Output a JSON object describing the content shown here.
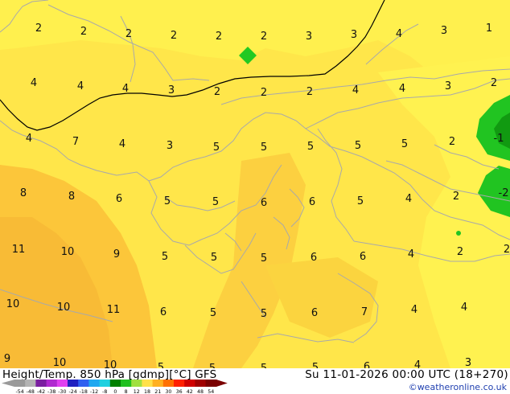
{
  "footer": {
    "title": "Height/Temp. 850 hPa [gdmp][°C] GFS",
    "datetime": "Su 11-01-2026 00:00 UTC (18+270)",
    "credit": "©weatheronline.co.uk"
  },
  "legend": {
    "ticks": [
      "-54",
      "-48",
      "-42",
      "-38",
      "-30",
      "-24",
      "-18",
      "-12",
      "-8",
      "0",
      "8",
      "12",
      "18",
      "21",
      "30",
      "36",
      "42",
      "48",
      "54"
    ],
    "colors": [
      "#9a9a9a",
      "#b4b4b4",
      "#7a1fa0",
      "#b02ad0",
      "#e040f0",
      "#2020c0",
      "#3060f0",
      "#20a8f0",
      "#20d0e0",
      "#008000",
      "#20c020",
      "#a0e040",
      "#ffe14a",
      "#ffb020",
      "#ff7000",
      "#ff2000",
      "#d00000",
      "#a00000",
      "#7a0000"
    ]
  },
  "map": {
    "labels": [
      [
        "2",
        48,
        35
      ],
      [
        "2",
        104,
        39
      ],
      [
        "2",
        160,
        42
      ],
      [
        "2",
        216,
        44
      ],
      [
        "2",
        272,
        45
      ],
      [
        "2",
        328,
        45
      ],
      [
        "3",
        384,
        45
      ],
      [
        "3",
        440,
        43
      ],
      [
        "4",
        496,
        42
      ],
      [
        "3",
        552,
        38
      ],
      [
        "1",
        608,
        35
      ],
      [
        "4",
        42,
        103
      ],
      [
        "4",
        100,
        107
      ],
      [
        "4",
        156,
        110
      ],
      [
        "3",
        213,
        112
      ],
      [
        "2",
        270,
        114
      ],
      [
        "2",
        328,
        115
      ],
      [
        "2",
        385,
        114
      ],
      [
        "4",
        442,
        112
      ],
      [
        "4",
        500,
        110
      ],
      [
        "3",
        557,
        107
      ],
      [
        "2",
        614,
        103
      ],
      [
        "4",
        36,
        172
      ],
      [
        "7",
        94,
        176
      ],
      [
        "4",
        152,
        179
      ],
      [
        "3",
        211,
        181
      ],
      [
        "5",
        269,
        183
      ],
      [
        "5",
        328,
        183
      ],
      [
        "5",
        386,
        182
      ],
      [
        "5",
        445,
        181
      ],
      [
        "5",
        503,
        179
      ],
      [
        "2",
        562,
        176
      ],
      [
        "-1",
        620,
        172
      ],
      [
        "8",
        29,
        240
      ],
      [
        "8",
        89,
        244
      ],
      [
        "6",
        148,
        247
      ],
      [
        "5",
        208,
        250
      ],
      [
        "5",
        268,
        251
      ],
      [
        "6",
        328,
        252
      ],
      [
        "6",
        388,
        251
      ],
      [
        "5",
        448,
        250
      ],
      [
        "4",
        508,
        247
      ],
      [
        "2",
        567,
        244
      ],
      [
        "-2",
        626,
        240
      ],
      [
        "11",
        23,
        310
      ],
      [
        "10",
        84,
        313
      ],
      [
        "9",
        145,
        316
      ],
      [
        "5",
        205,
        319
      ],
      [
        "5",
        266,
        320
      ],
      [
        "5",
        328,
        321
      ],
      [
        "6",
        390,
        320
      ],
      [
        "6",
        451,
        319
      ],
      [
        "4",
        511,
        316
      ],
      [
        "2",
        572,
        313
      ],
      [
        "2",
        630,
        310
      ],
      [
        "10",
        16,
        378
      ],
      [
        "10",
        79,
        382
      ],
      [
        "11",
        141,
        385
      ],
      [
        "6",
        203,
        388
      ],
      [
        "5",
        265,
        389
      ],
      [
        "5",
        328,
        390
      ],
      [
        "6",
        391,
        389
      ],
      [
        "7",
        453,
        388
      ],
      [
        "4",
        515,
        385
      ],
      [
        "4",
        577,
        382
      ],
      [
        "9",
        9,
        446
      ],
      [
        "10",
        74,
        451
      ],
      [
        "10",
        137,
        454
      ],
      [
        "5",
        200,
        457
      ],
      [
        "5",
        264,
        458
      ],
      [
        "5",
        328,
        458
      ],
      [
        "5",
        392,
        457
      ],
      [
        "6",
        456,
        456
      ],
      [
        "4",
        519,
        454
      ],
      [
        "3",
        582,
        451
      ]
    ]
  }
}
